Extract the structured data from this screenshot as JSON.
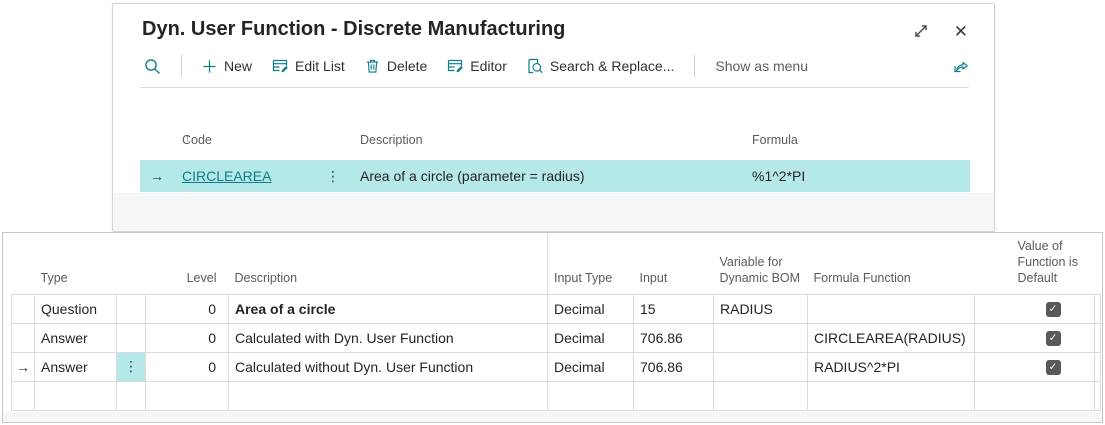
{
  "glyphs": {
    "current_row_arrow": "→",
    "row_menu": "⋮",
    "sort_ascending": "↑",
    "check": "✓",
    "close": "✕"
  },
  "colors": {
    "accent_teal": "#0e7d87",
    "selection_cyan": "#b5e9e9",
    "checkbox_fill": "#5b5958"
  },
  "dialog": {
    "title": "Dyn. User Function - Discrete Manufacturing",
    "toolbar": {
      "new": "New",
      "edit_list": "Edit List",
      "delete": "Delete",
      "editor": "Editor",
      "search_replace": "Search & Replace...",
      "show_as_menu": "Show as menu"
    },
    "functions_table": {
      "columns": {
        "code": "Code",
        "description": "Description",
        "formula": "Formula"
      },
      "row": {
        "code": "CIRCLEAREA",
        "description": "Area of a circle (parameter = radius)",
        "formula": "%1^2*PI"
      }
    }
  },
  "lines": {
    "columns": {
      "type": "Type",
      "level": "Level",
      "description": "Description",
      "input_type": "Input Type",
      "input": "Input",
      "variable_for_dynamic_bom": "Variable for Dynamic BOM",
      "formula_function": "Formula Function",
      "value_of_function_is_default": "Value of Function is Default"
    },
    "rows": [
      {
        "type": "Question",
        "level": "0",
        "description": "Area of a circle",
        "input_type": "Decimal",
        "input": "15",
        "variable_for_dynamic_bom": "RADIUS",
        "formula_function": "",
        "value_default": true
      },
      {
        "type": "Answer",
        "level": "0",
        "description": "Calculated with Dyn. User Function",
        "input_type": "Decimal",
        "input": "706.86",
        "variable_for_dynamic_bom": "",
        "formula_function": "CIRCLEAREA(RADIUS)",
        "value_default": true
      },
      {
        "type": "Answer",
        "level": "0",
        "description": "Calculated without Dyn. User Function",
        "input_type": "Decimal",
        "input": "706.86",
        "variable_for_dynamic_bom": "",
        "formula_function": "RADIUS^2*PI",
        "value_default": true
      },
      {
        "type": "",
        "level": "",
        "description": "",
        "input_type": "",
        "input": "",
        "variable_for_dynamic_bom": "",
        "formula_function": "",
        "value_default": false
      }
    ]
  }
}
